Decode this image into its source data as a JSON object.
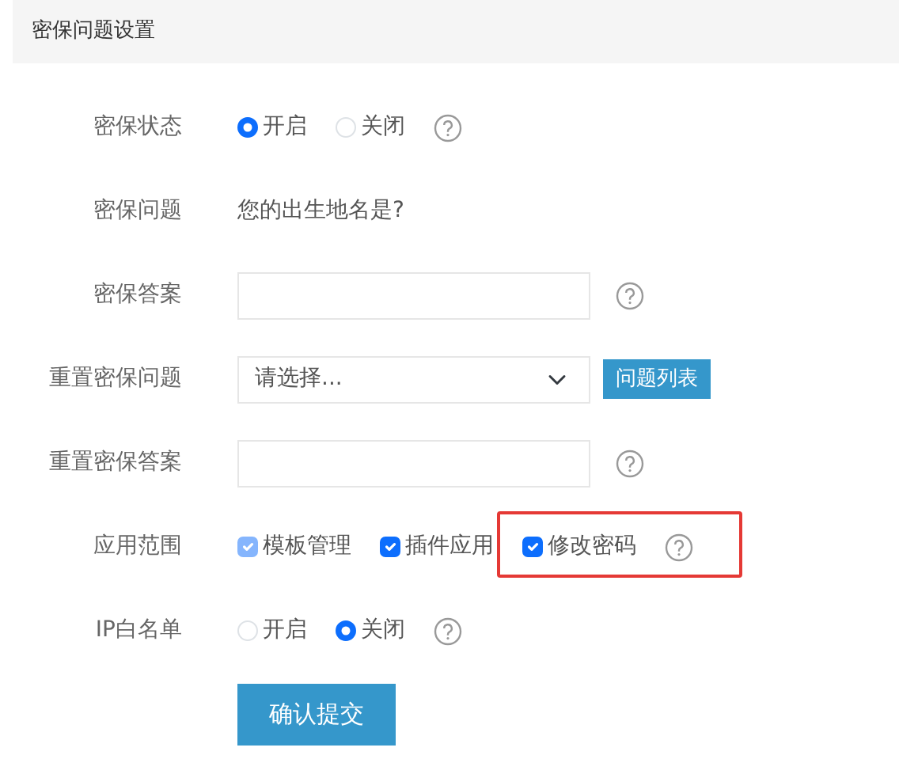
{
  "section_title": "密保问题设置",
  "fields": [
    {
      "kind": "radio",
      "label": "密保状态",
      "options": [
        {
          "label": "开启",
          "selected": true
        },
        {
          "label": "关闭",
          "selected": false
        }
      ],
      "help": true
    },
    {
      "kind": "text",
      "label": "密保问题",
      "value": "您的出生地名是?"
    },
    {
      "kind": "input",
      "label": "密保答案",
      "help": true
    },
    {
      "kind": "select",
      "label": "重置密保问题",
      "value": "请选择...",
      "button": "问题列表"
    },
    {
      "kind": "input",
      "label": "重置密保答案",
      "help": true
    },
    {
      "kind": "checkboxes",
      "label": "应用范围",
      "options": [
        {
          "label": "模板管理",
          "checked": true,
          "disabled": true,
          "highlighted": false
        },
        {
          "label": "插件应用",
          "checked": true,
          "disabled": false,
          "highlighted": false
        },
        {
          "label": "修改密码",
          "checked": true,
          "disabled": false,
          "highlighted": true
        }
      ],
      "help": true
    },
    {
      "kind": "radio",
      "label": "IP白名单",
      "options": [
        {
          "label": "开启",
          "selected": false
        },
        {
          "label": "关闭",
          "selected": true
        }
      ],
      "help": true
    }
  ],
  "submit": "确认提交"
}
